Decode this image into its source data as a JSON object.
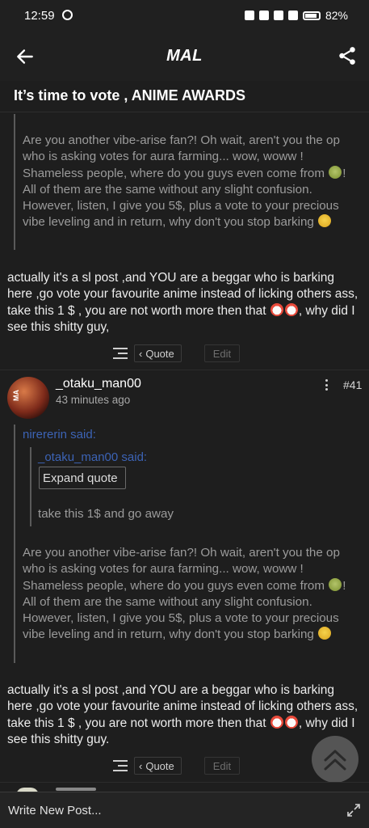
{
  "status_bar": {
    "time": "12:59",
    "battery": "82%"
  },
  "app_bar": {
    "logo": "MAL",
    "back_icon": "arrow-left-icon",
    "share_icon": "share-icon"
  },
  "thread": {
    "title": "It’s time to vote , ANIME AWARDS"
  },
  "post_prev": {
    "quote_paragraph": {
      "part1": "Are you another vibe-arise fan?! Oh wait, aren't you the op who is asking votes for aura farming... wow, woww ! Shameless people, where do you guys even come from ",
      "part2": "! All of them are the same without any slight confusion. However, listen, I give you 5$, plus a vote to your precious vibe leveling and in return, why don't you stop barking "
    },
    "body": {
      "part1": "actually it's a sl post ,and YOU are a beggar who is barking here ,go vote your favourite anime instead of licking others ass, take this 1 $ , you are not worth more then that ",
      "part2": ", why did I see this shitty guy,"
    },
    "quote_label": "Quote",
    "edit_label": "Edit"
  },
  "post_41": {
    "username": "_otaku_man00",
    "time_ago": "43 minutes ago",
    "post_number": "#41",
    "avatar_text": "MA",
    "outer_quote_author": "nirererin said:",
    "inner_quote_author": "_otaku_man00 said:",
    "expand_quote_label": "Expand quote",
    "inner_quote_text": "take this 1$ and go away",
    "quote_paragraph": {
      "part1": "Are you another vibe-arise fan?! Oh wait, aren't you the op who is asking votes for aura farming... wow, woww ! Shameless people, where do you guys even come from ",
      "part2": "! All of them are the same without any slight confusion. However, listen, I give you 5$, plus a vote to your precious vibe leveling and in return, why don't you stop barking "
    },
    "body": {
      "part1": "actually it's a sl post ,and YOU are a beggar who is barking here ,go vote your favourite anime instead of licking others ass, take this 1 $ , you are not worth more then that ",
      "part2": ", why did I see this shitty guy."
    },
    "quote_label": "Quote",
    "edit_label": "Edit"
  },
  "composer": {
    "placeholder": "Write New Post..."
  },
  "colors": {
    "link_blue": "#3c63b5",
    "background": "#1e1e1e"
  }
}
